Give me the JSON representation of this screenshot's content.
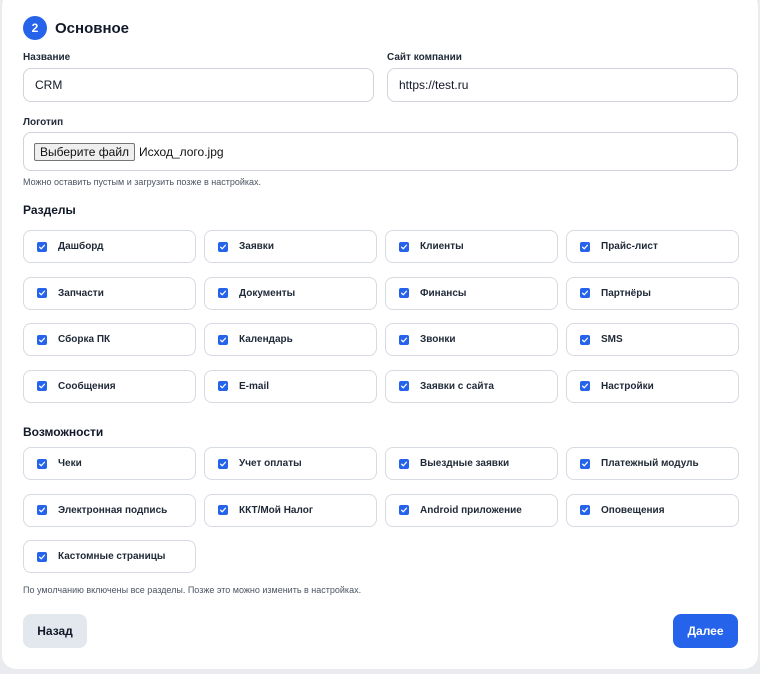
{
  "step": {
    "number": "2",
    "title": "Основное"
  },
  "fields": {
    "name": {
      "label": "Название",
      "value": "CRM"
    },
    "site": {
      "label": "Сайт компании",
      "value": "https://test.ru"
    },
    "logo": {
      "label": "Логотип",
      "button": "Выберите файл",
      "file_name": "Исход_лого.jpg",
      "hint": "Можно оставить пустым и загрузить позже в настройках."
    }
  },
  "sections": {
    "title": "Разделы",
    "items": [
      {
        "label": "Дашборд",
        "checked": true
      },
      {
        "label": "Заявки",
        "checked": true
      },
      {
        "label": "Клиенты",
        "checked": true
      },
      {
        "label": "Прайс-лист",
        "checked": true
      },
      {
        "label": "Запчасти",
        "checked": true
      },
      {
        "label": "Документы",
        "checked": true
      },
      {
        "label": "Финансы",
        "checked": true
      },
      {
        "label": "Партнёры",
        "checked": true
      },
      {
        "label": "Сборка ПК",
        "checked": true
      },
      {
        "label": "Календарь",
        "checked": true
      },
      {
        "label": "Звонки",
        "checked": true
      },
      {
        "label": "SMS",
        "checked": true
      },
      {
        "label": "Сообщения",
        "checked": true
      },
      {
        "label": "E-mail",
        "checked": true
      },
      {
        "label": "Заявки с сайта",
        "checked": true
      },
      {
        "label": "Настройки",
        "checked": true
      }
    ]
  },
  "features": {
    "title": "Возможности",
    "items": [
      {
        "label": "Чеки",
        "checked": true
      },
      {
        "label": "Учет оплаты",
        "checked": true
      },
      {
        "label": "Выездные заявки",
        "checked": true
      },
      {
        "label": "Платежный модуль",
        "checked": true
      },
      {
        "label": "Электронная подпись",
        "checked": true
      },
      {
        "label": "ККТ/Мой Налог",
        "checked": true
      },
      {
        "label": "Android приложение",
        "checked": true
      },
      {
        "label": "Оповещения",
        "checked": true
      },
      {
        "label": "Кастомные страницы",
        "checked": true
      }
    ],
    "hint": "По умолчанию включены все разделы. Позже это можно изменить в настройках."
  },
  "actions": {
    "back": "Назад",
    "next": "Далее"
  },
  "colors": {
    "accent": "#2563eb",
    "back_bg": "#e3e8ef"
  }
}
